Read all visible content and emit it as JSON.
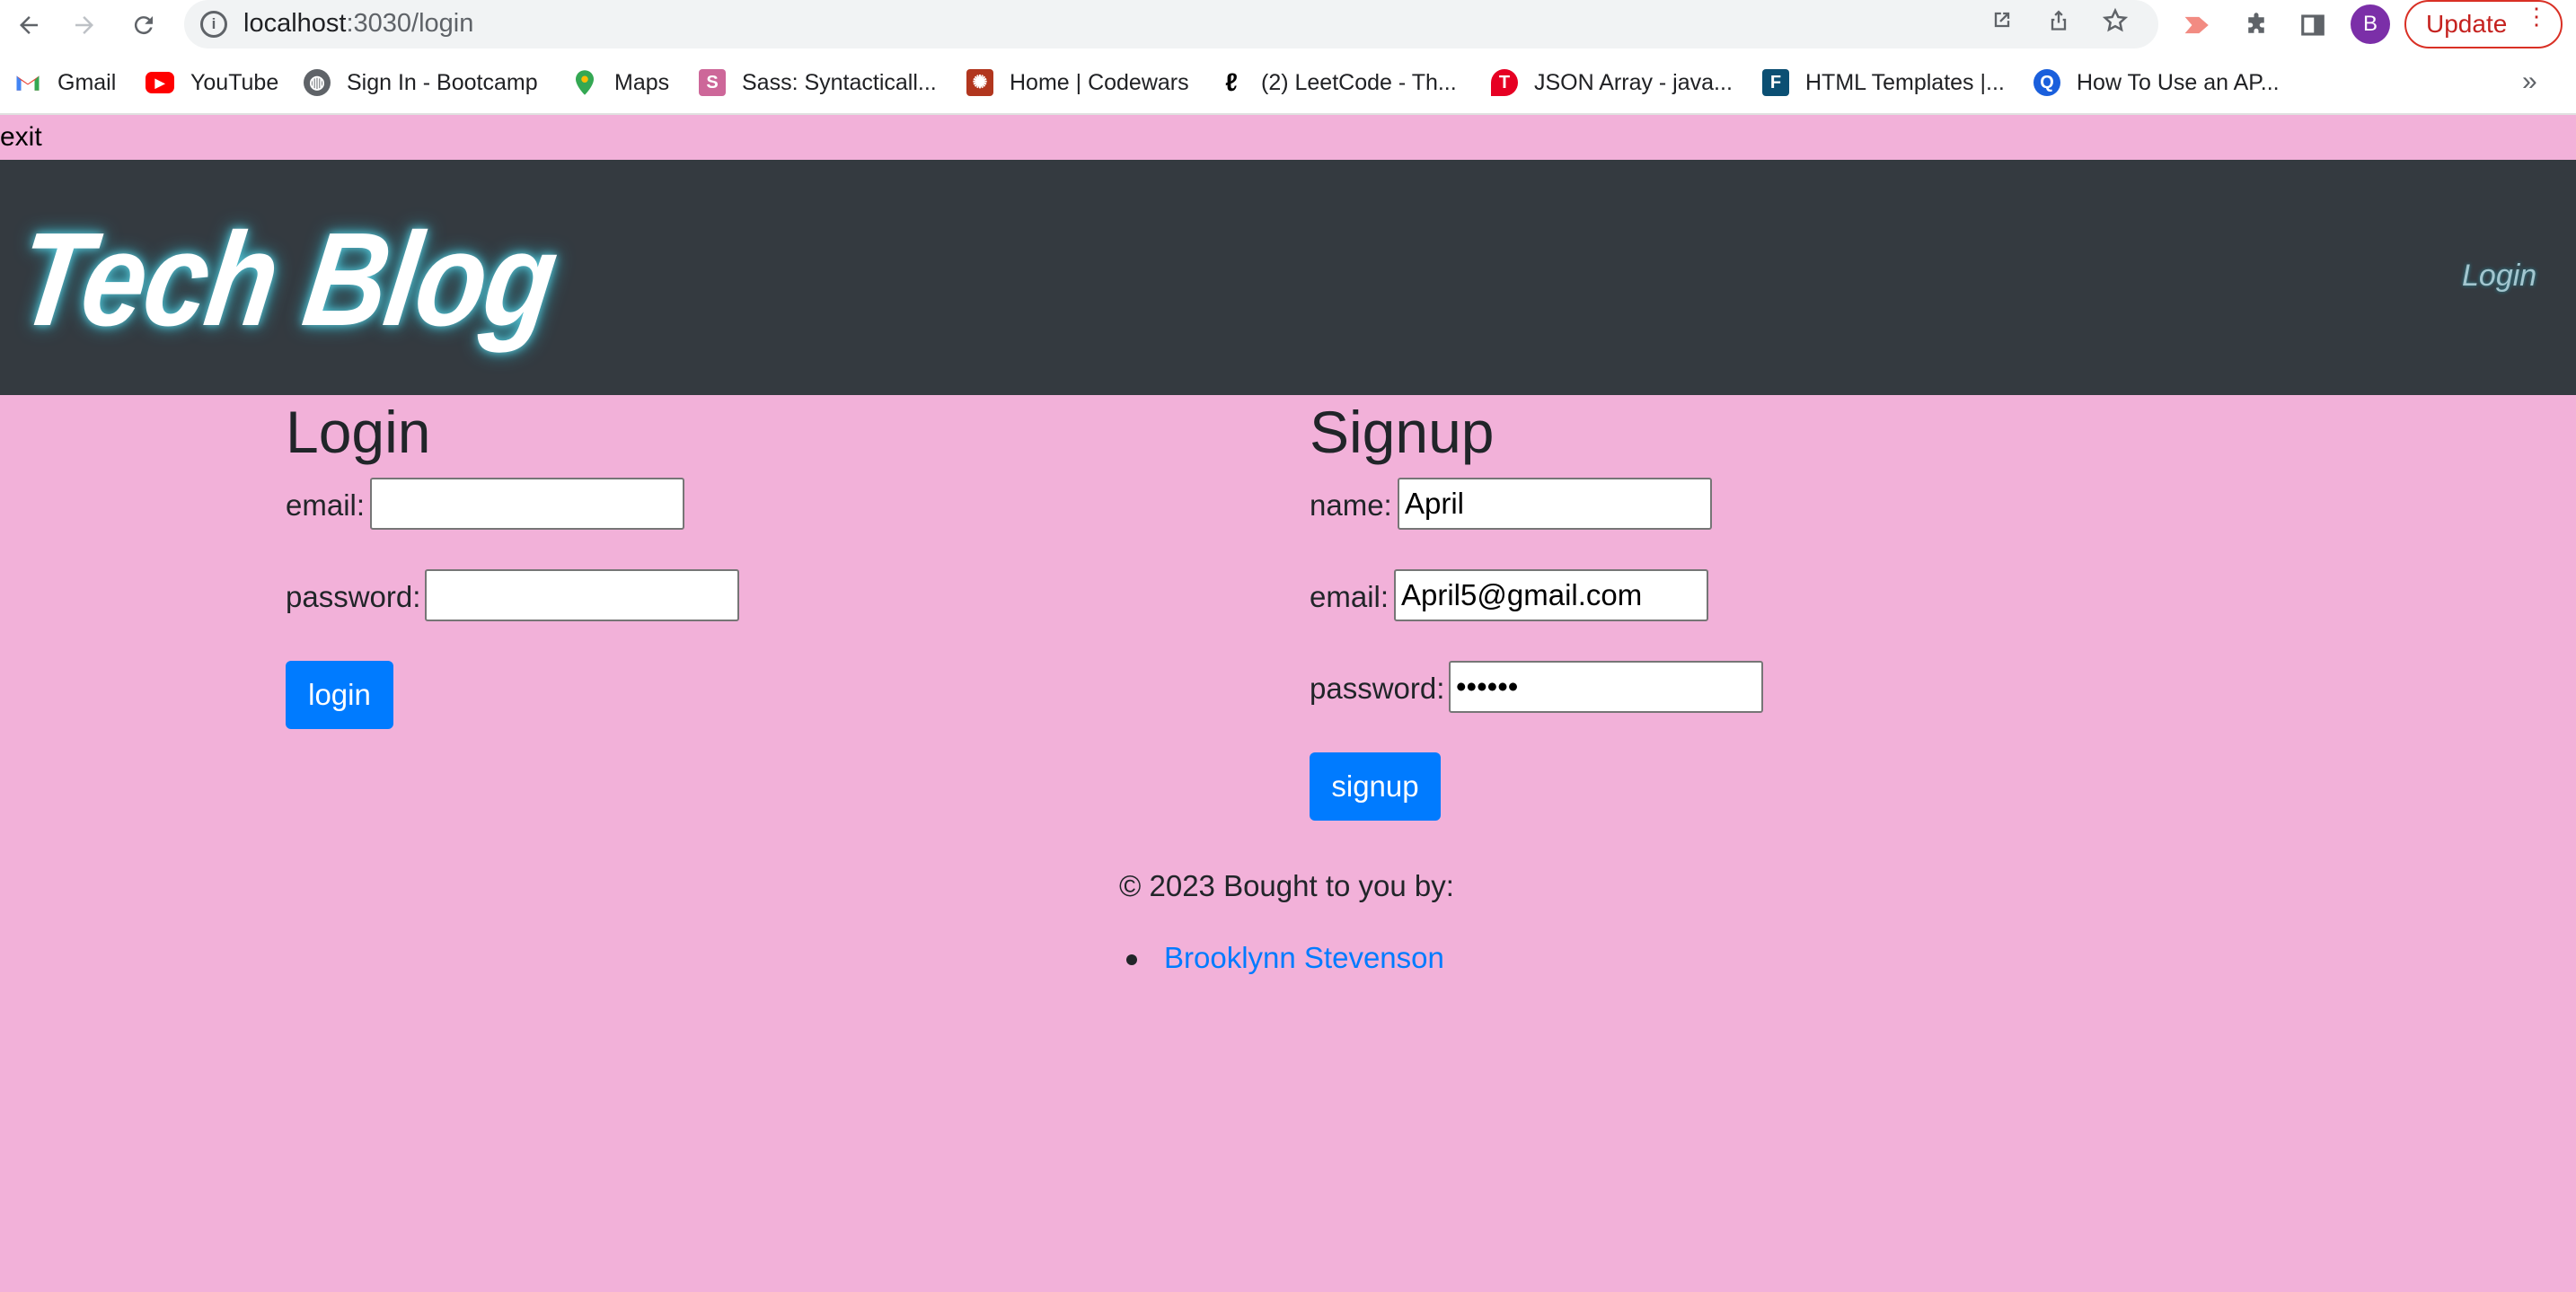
{
  "browser": {
    "url_host": "localhost",
    "url_path": ":3030/login",
    "avatar_letter": "B",
    "update_label": "Update",
    "bookmarks": [
      {
        "label": "Gmail",
        "icon": "gmail-icon",
        "color": "#ea4335"
      },
      {
        "label": "YouTube",
        "icon": "youtube-icon",
        "color": "#ff0000"
      },
      {
        "label": "Sign In - Bootcamp",
        "icon": "globe-icon",
        "color": "#5f6368"
      },
      {
        "label": "Maps",
        "icon": "maps-pin-icon",
        "color": "#34a853"
      },
      {
        "label": "Sass: Syntacticall...",
        "icon": "sass-icon",
        "color": "#cd6799"
      },
      {
        "label": "Home | Codewars",
        "icon": "codewars-icon",
        "color": "#b1361e"
      },
      {
        "label": "(2) LeetCode - Th...",
        "icon": "leetcode-icon",
        "color": "#ffa116"
      },
      {
        "label": "JSON Array - java...",
        "icon": "tutorial-t-icon",
        "color": "#e60023"
      },
      {
        "label": "HTML Templates |...",
        "icon": "f-square-icon",
        "color": "#0b4f73"
      },
      {
        "label": "How To Use an AP...",
        "icon": "q-logo-icon",
        "color": "#1a5fdc"
      }
    ]
  },
  "page": {
    "exit_text": "exit",
    "brand": "Tech Blog",
    "nav_login": "Login"
  },
  "login": {
    "heading": "Login",
    "email_label": "email:",
    "email_value": "",
    "password_label": "password:",
    "password_value": "",
    "button_label": "login"
  },
  "signup": {
    "heading": "Signup",
    "name_label": "name:",
    "name_value": "April",
    "email_label": "email:",
    "email_value": "April5@gmail.com",
    "password_label": "password:",
    "password_value": "••••••",
    "button_label": "signup"
  },
  "footer": {
    "text": "© 2023 Bought to you by:",
    "author": "Brooklynn Stevenson"
  }
}
